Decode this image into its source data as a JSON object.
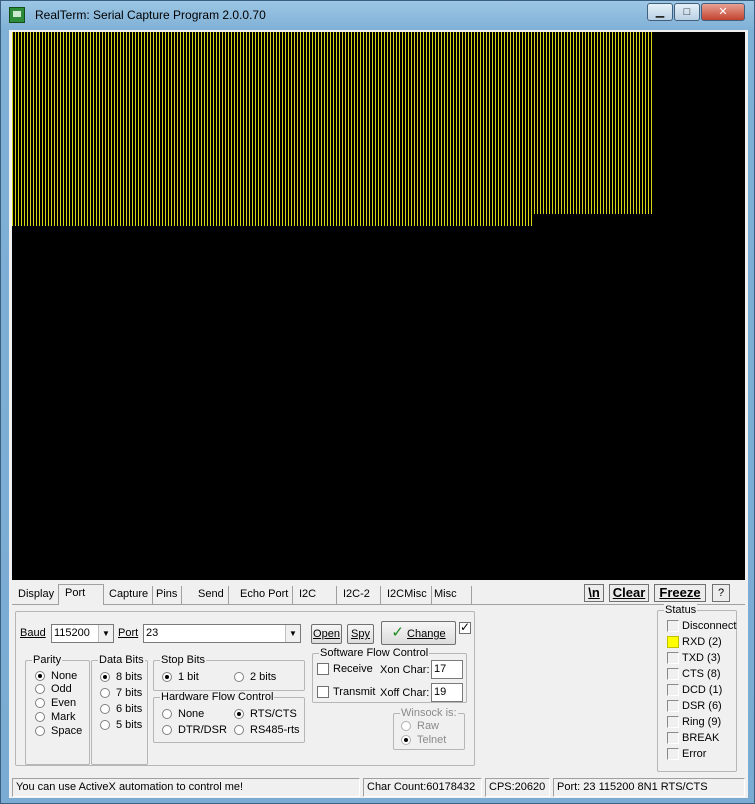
{
  "window": {
    "title": "RealTerm: Serial Capture Program 2.0.0.70",
    "buttons": {
      "minimize": "▁",
      "maximize": "□",
      "close": "✕"
    }
  },
  "terminal": {
    "background": "#000000",
    "text_color": "#d6d616"
  },
  "tabs": [
    "Display",
    "Port",
    "Capture",
    "Pins",
    "Send",
    "Echo Port",
    "I2C",
    "I2C-2",
    "I2CMisc",
    "Misc"
  ],
  "active_tab": "Port",
  "toolbar": {
    "newline": "\\n",
    "clear": "Clear",
    "freeze": "Freeze",
    "help": "?"
  },
  "port": {
    "baud_label": "Baud",
    "baud_value": "115200",
    "port_label": "Port",
    "port_value": "23",
    "open_label": "Open",
    "spy_label": "Spy",
    "change_label": "Change",
    "change_checked": true
  },
  "parity": {
    "title": "Parity",
    "options": [
      "None",
      "Odd",
      "Even",
      "Mark",
      "Space"
    ],
    "selected": "None"
  },
  "data_bits": {
    "title": "Data Bits",
    "options": [
      "8 bits",
      "7 bits",
      "6 bits",
      "5 bits"
    ],
    "selected": "8 bits"
  },
  "stop_bits": {
    "title": "Stop Bits",
    "options": [
      "1 bit",
      "2 bits"
    ],
    "selected": "1 bit"
  },
  "hw_flow": {
    "title": "Hardware Flow Control",
    "options": [
      "None",
      "RTS/CTS",
      "DTR/DSR",
      "RS485-rts"
    ],
    "selected": "RTS/CTS"
  },
  "sw_flow": {
    "title": "Software Flow Control",
    "receive_label": "Receive",
    "transmit_label": "Transmit",
    "xon_label": "Xon Char:",
    "xon_value": "17",
    "xoff_label": "Xoff Char:",
    "xoff_value": "19"
  },
  "winsock": {
    "title": "Winsock is:",
    "options": [
      "Raw",
      "Telnet"
    ],
    "selected": "Telnet"
  },
  "status": {
    "title": "Status",
    "items": [
      {
        "label": "Disconnect",
        "on": false
      },
      {
        "label": "RXD (2)",
        "on": true
      },
      {
        "label": "TXD (3)",
        "on": false
      },
      {
        "label": "CTS (8)",
        "on": false
      },
      {
        "label": "DCD (1)",
        "on": false
      },
      {
        "label": "DSR (6)",
        "on": false
      },
      {
        "label": "Ring (9)",
        "on": false
      },
      {
        "label": "BREAK",
        "on": false
      },
      {
        "label": "Error",
        "on": false
      }
    ],
    "led_on_color": "#ffff00"
  },
  "statusbar": {
    "message": "You can use ActiveX automation to control me!",
    "char_count": "Char Count:60178432",
    "cps": "CPS:20620",
    "port_info": "Port: 23 115200 8N1 RTS/CTS"
  }
}
